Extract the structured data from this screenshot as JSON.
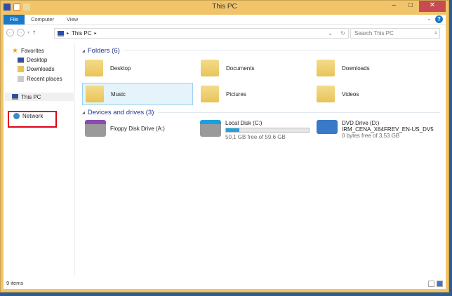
{
  "window": {
    "title": "This PC",
    "minimize": "–",
    "maximize": "□",
    "close": "✕"
  },
  "ribbon": {
    "tabs": [
      "File",
      "Computer",
      "View"
    ],
    "help": "?"
  },
  "nav": {
    "back": "←",
    "forward": "→",
    "up": "↑",
    "breadcrumb": "This PC",
    "search_placeholder": "Search This PC",
    "refresh": "↻"
  },
  "sidebar": {
    "favorites": "Favorites",
    "items": [
      "Desktop",
      "Downloads",
      "Recent places"
    ],
    "this_pc": "This PC",
    "network": "Network"
  },
  "folders": {
    "header": "Folders (6)",
    "items": [
      "Desktop",
      "Documents",
      "Downloads",
      "Music",
      "Pictures",
      "Videos"
    ],
    "selected": "Music"
  },
  "devices": {
    "header": "Devices and drives (3)",
    "items": [
      {
        "name": "Floppy Disk Drive (A:)"
      },
      {
        "name": "Local Disk (C:)",
        "free": "50,1 GB free of 59,6 GB",
        "used_fraction": 0.16
      },
      {
        "name": "DVD Drive (D:)",
        "label": "IRM_CENA_X64FREV_EN-US_DV5",
        "free": "0 bytes free of 3,53 GB"
      }
    ]
  },
  "status": {
    "count": "9 items"
  },
  "colors": {
    "accent": "#1979ca",
    "frame": "#f2c46a",
    "highlight": "#e0001a"
  }
}
